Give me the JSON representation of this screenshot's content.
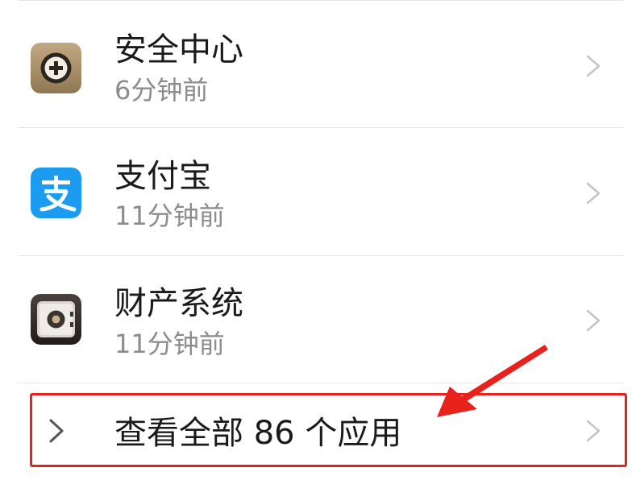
{
  "apps": [
    {
      "name": "安全中心",
      "time": "6分钟前",
      "icon": "security-center-icon",
      "icon_bg": "#a8906c"
    },
    {
      "name": "支付宝",
      "time": "11分钟前",
      "icon": "alipay-icon",
      "icon_bg": "#1b9cf0"
    },
    {
      "name": "财产系统",
      "time": "11分钟前",
      "icon": "safe-vault-icon",
      "icon_bg": "#3a3330"
    }
  ],
  "view_all": {
    "label": "查看全部 86 个应用"
  },
  "annotation": {
    "highlight_color": "#e8211d"
  }
}
